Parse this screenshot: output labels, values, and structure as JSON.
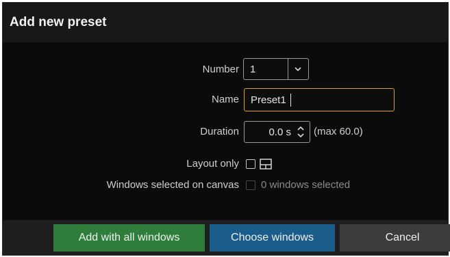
{
  "dialog": {
    "title": "Add new preset"
  },
  "form": {
    "number": {
      "label": "Number",
      "value": "1"
    },
    "name": {
      "label": "Name",
      "value": "Preset1"
    },
    "duration": {
      "label": "Duration",
      "value": "0.0 s",
      "hint": "(max 60.0)"
    },
    "layout_only": {
      "label": "Layout only",
      "checked": false,
      "icon": "layout-icon"
    },
    "windows_selected": {
      "label": "Windows selected on canvas",
      "value": "0 windows selected",
      "checked": false,
      "enabled": false
    }
  },
  "footer": {
    "add_all_label": "Add with all windows",
    "choose_label": "Choose windows",
    "cancel_label": "Cancel"
  },
  "colors": {
    "accent_focus": "#e0a11b",
    "green_button": "#2f7d3a",
    "blue_button": "#1a5c8a",
    "grey_button": "#3c3c3c"
  }
}
